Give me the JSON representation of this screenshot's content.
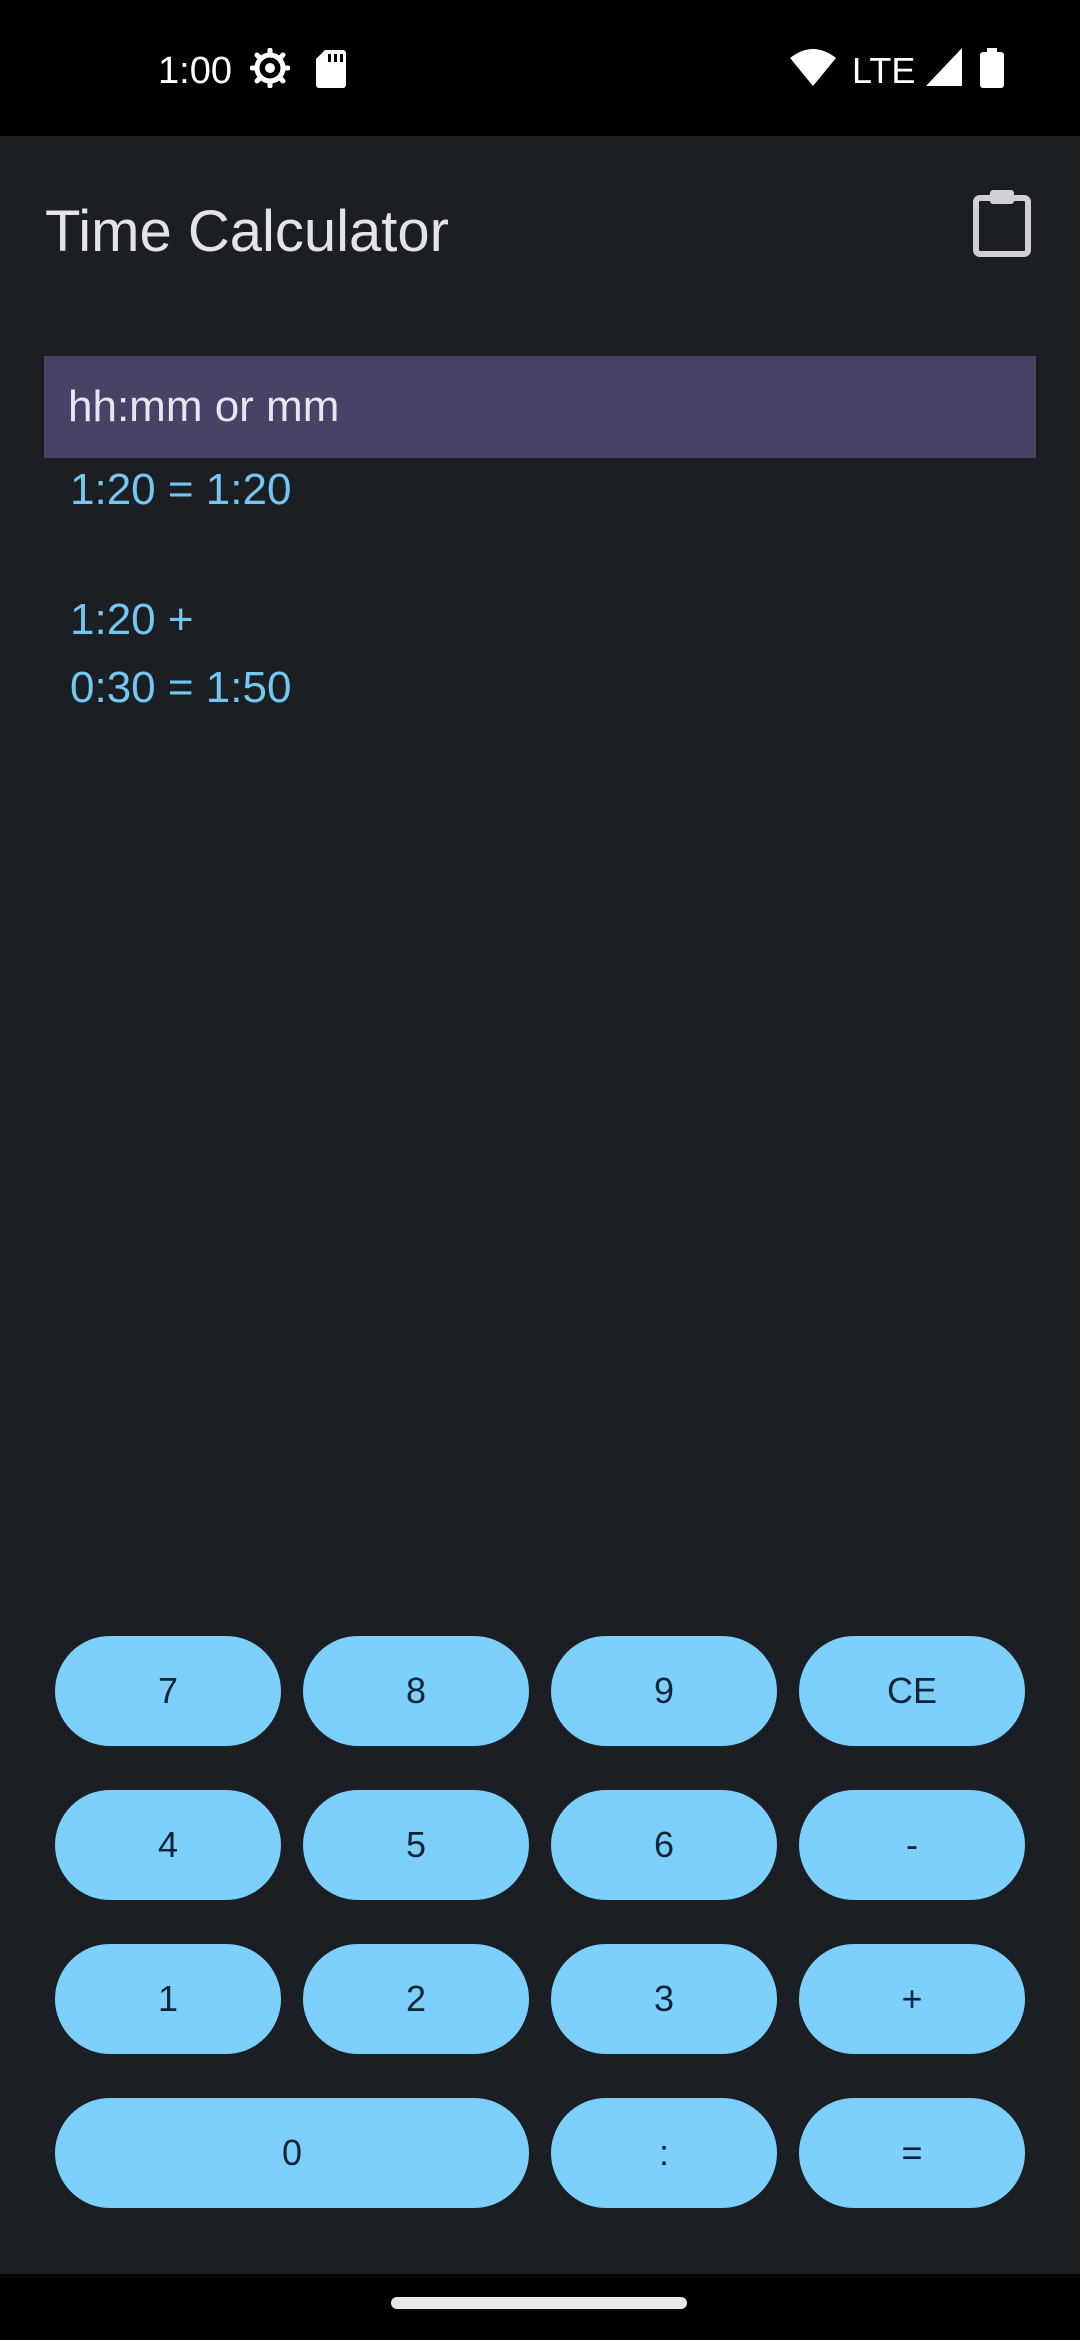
{
  "status_bar": {
    "time": "1:00",
    "network": "LTE",
    "icons": [
      "settings-icon",
      "sd-card-icon",
      "wifi-icon",
      "signal-icon",
      "battery-icon"
    ]
  },
  "app_bar": {
    "title": "Time Calculator",
    "action_icon": "clipboard-icon"
  },
  "input": {
    "placeholder": "hh:mm or mm",
    "value": ""
  },
  "history": {
    "lines": [
      "1:20 = 1:20",
      "1:20 +",
      "0:30 = 1:50"
    ]
  },
  "keypad": {
    "k7": "7",
    "k8": "8",
    "k9": "9",
    "ce": "CE",
    "k4": "4",
    "k5": "5",
    "k6": "6",
    "minus": "-",
    "k1": "1",
    "k2": "2",
    "k3": "3",
    "plus": "+",
    "k0": "0",
    "colon": ":",
    "equals": "="
  },
  "colors": {
    "background": "#1b1e22",
    "input_background": "#4a4266",
    "history_text": "#74c7f2",
    "key_background": "#7dd0fb",
    "key_text": "#0d2535"
  }
}
